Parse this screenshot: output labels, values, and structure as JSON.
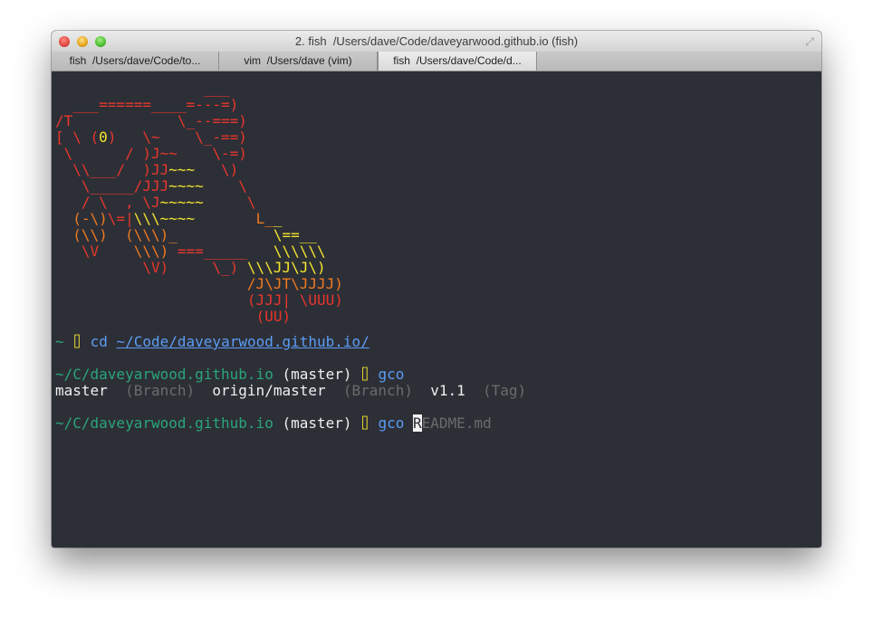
{
  "window": {
    "title": "2. fish  /Users/dave/Code/daveyarwood.github.io (fish)"
  },
  "tabs": [
    {
      "label": "fish  /Users/dave/Code/to..."
    },
    {
      "label": "vim  /Users/dave (vim)"
    },
    {
      "label": "fish  /Users/dave/Code/d..."
    }
  ],
  "art": [
    [
      {
        "t": "                 ___",
        "c": "red"
      }
    ],
    [
      {
        "t": "  ___======____=---=)",
        "c": "red"
      }
    ],
    [
      {
        "t": "/T            \\_--===)",
        "c": "red"
      }
    ],
    [
      {
        "t": "[ \\ (",
        "c": "red"
      },
      {
        "t": "0",
        "c": "yellow"
      },
      {
        "t": ")   \\~    \\_-==)",
        "c": "red"
      }
    ],
    [
      {
        "t": " \\      / )J~~    \\-=)",
        "c": "red"
      }
    ],
    [
      {
        "t": "  \\\\___/  )JJ",
        "c": "red"
      },
      {
        "t": "~~~",
        "c": "yellow"
      },
      {
        "t": "   \\)",
        "c": "red"
      }
    ],
    [
      {
        "t": "   \\_____/JJJ",
        "c": "red"
      },
      {
        "t": "~~~~",
        "c": "yellow"
      },
      {
        "t": "    \\",
        "c": "red"
      }
    ],
    [
      {
        "t": "   / \\  , \\J",
        "c": "red"
      },
      {
        "t": "~~~~~",
        "c": "yellow"
      },
      {
        "t": "     \\",
        "c": "red"
      }
    ],
    [
      {
        "t": "  (-\\)",
        "c": "orange"
      },
      {
        "t": "\\=|",
        "c": "red"
      },
      {
        "t": "\\\\\\",
        "c": "yellow"
      },
      {
        "t": "~~~~",
        "c": "yellow"
      },
      {
        "t": "       L_",
        "c": "orange"
      },
      {
        "t": "_",
        "c": "yellow"
      }
    ],
    [
      {
        "t": "  (\\\\)  (\\\\\\)_           ",
        "c": "orange"
      },
      {
        "t": "\\==__",
        "c": "yellow"
      }
    ],
    [
      {
        "t": "   \\V    ",
        "c": "red"
      },
      {
        "t": "\\\\\\) ",
        "c": "orange"
      },
      {
        "t": "===_____",
        "c": "red"
      },
      {
        "t": "   \\\\\\\\\\\\",
        "c": "yellow"
      }
    ],
    [
      {
        "t": "          \\V)     ",
        "c": "red"
      },
      {
        "t": "\\_) ",
        "c": "red"
      },
      {
        "t": "\\\\\\JJ\\J\\)",
        "c": "yellow"
      }
    ],
    [
      {
        "t": "                      ",
        "c": "red"
      },
      {
        "t": "/J\\JT\\JJJJ)",
        "c": "orange"
      }
    ],
    [
      {
        "t": "                      ",
        "c": "red"
      },
      {
        "t": "(JJJ| \\UUU)",
        "c": "red"
      }
    ],
    [
      {
        "t": "                       ",
        "c": "red"
      },
      {
        "t": "(UU)",
        "c": "red"
      }
    ]
  ],
  "line1": {
    "prompt": "~",
    "icon": "⌷",
    "cmd": "cd",
    "arg": "~/Code/daveyarwood.github.io/"
  },
  "line2": {
    "cwd": "~/C/daveyarwood.github.io",
    "branch": "(master)",
    "icon": "⌷",
    "cmd": "gco"
  },
  "line3": {
    "c1": "master",
    "c1tag": "(Branch)",
    "c2": "origin/master",
    "c2tag": "(Branch)",
    "c3": "v1.1",
    "c3tag": "(Tag)"
  },
  "line4": {
    "cwd": "~/C/daveyarwood.github.io",
    "branch": "(master)",
    "icon": "⌷",
    "cmd": "gco",
    "cursor": "R",
    "suggest": "EADME.md"
  }
}
